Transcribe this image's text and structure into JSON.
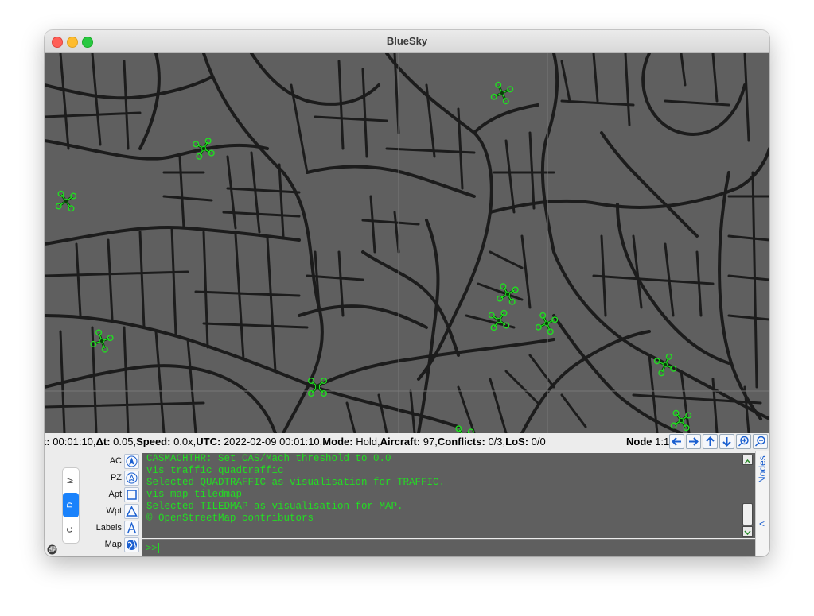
{
  "window": {
    "title": "BlueSky"
  },
  "status": {
    "t_label": "t:",
    "t_value": "00:01:10",
    "dt_label": "Δt:",
    "dt_value": "0.05",
    "speed_label": "Speed:",
    "speed_value": "0.0x",
    "utc_label": "UTC:",
    "utc_value": "2022-02-09 00:01:10",
    "mode_label": "Mode:",
    "mode_value": "Hold",
    "aircraft_label": "Aircraft:",
    "aircraft_value": "97",
    "conflicts_label": "Conflicts:",
    "conflicts_value": "0/3",
    "los_label": "LoS:",
    "los_value": "0/0",
    "node_label": "Node",
    "node_value": "1:1"
  },
  "side_tabs": [
    "M",
    "D",
    "C"
  ],
  "active_tab": "D",
  "toolbar": [
    {
      "label": "AC",
      "icon": "aircraft-symbol-icon"
    },
    {
      "label": "PZ",
      "icon": "protected-zone-icon"
    },
    {
      "label": "Apt",
      "icon": "airport-square-icon"
    },
    {
      "label": "Wpt",
      "icon": "waypoint-triangle-icon"
    },
    {
      "label": "Labels",
      "icon": "label-letter-icon"
    },
    {
      "label": "Map",
      "icon": "globe-icon"
    }
  ],
  "console": {
    "lines": [
      "CASMACHTHR: Set CAS/Mach threshold to 0.0",
      "vis traffic quadtraffic",
      "Selected QUADTRAFFIC as visualisation for TRAFFIC.",
      "vis map tiledmap",
      "Selected TILEDMAP as visualisation for MAP.",
      "© OpenStreetMap contributors"
    ],
    "prompt": ">>"
  },
  "nodes_panel": {
    "label": "Nodes",
    "toggle": "<"
  },
  "colors": {
    "map_background": "#5f5f5f",
    "road": "#1c1c1c",
    "aircraft": "#22dd22",
    "console_text": "#22dd22",
    "active_tab": "#1a82fb"
  }
}
